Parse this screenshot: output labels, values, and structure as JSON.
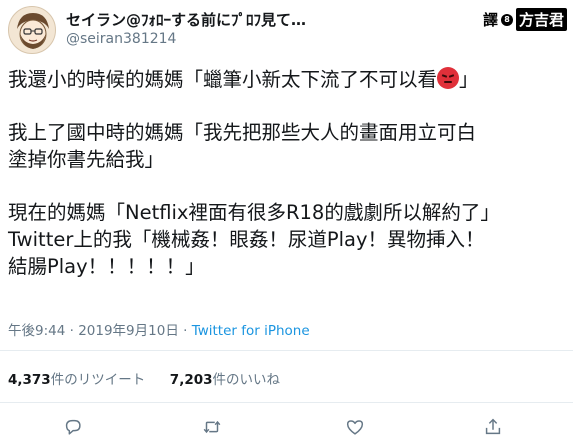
{
  "user": {
    "display_name": "セイラン@ﾌｫﾛｰする前にﾌﾟﾛﾌ見て…",
    "handle": "@seiran381214"
  },
  "watermark": {
    "prefix": "譯",
    "dot": "8",
    "name": "方吉君"
  },
  "tweet": {
    "lines": [
      "我還小的時候的媽媽「蠟筆小新太下流了不可以看",
      "」",
      "我上了國中時的媽媽「我先把那些大人的畫面用立可白",
      "塗掉你書先給我」",
      "現在的媽媽「Netflix裡面有很多R18的戲劇所以解約了」",
      "Twitter上的我「機械姦！眼姦！尿道Play！異物挿入！",
      "結腸Play！！！！！」"
    ],
    "emoji": "pouting-face"
  },
  "meta": {
    "time": "午後9:44",
    "sep": " · ",
    "date": "2019年9月10日",
    "source": "Twitter for iPhone"
  },
  "stats": {
    "retweets": "4,373",
    "retweets_label": "件のリツイート",
    "likes": "7,203",
    "likes_label": "件のいいね"
  },
  "colors": {
    "text": "#14171a",
    "secondary": "#657786",
    "link": "#1b95e0",
    "divider": "#e6ecf0"
  },
  "icons": [
    "reply-icon",
    "retweet-icon",
    "like-icon",
    "share-icon"
  ]
}
